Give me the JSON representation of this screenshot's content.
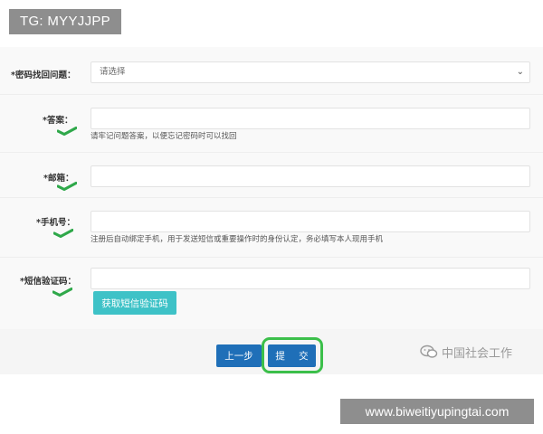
{
  "watermarks": {
    "top_left": "TG: MYYJJPP",
    "bottom_right": "www.biweitiyupingtai.com"
  },
  "form": {
    "security_question": {
      "label": "*密码找回问题：",
      "selected": "请选择"
    },
    "answer": {
      "label": "*答案：",
      "value": "",
      "hint": "请牢记问题答案，以便忘记密码时可以找回"
    },
    "email": {
      "label": "*邮箱：",
      "value": ""
    },
    "phone": {
      "label": "*手机号：",
      "value": "",
      "hint": "注册后自动绑定手机，用于发送短信或重要操作时的身份认定，务必填写本人现用手机"
    },
    "sms_code": {
      "label": "*短信验证码：",
      "value": "",
      "button": "获取短信验证码"
    }
  },
  "actions": {
    "prev": "上一步",
    "submit": "提 交"
  },
  "brand": {
    "name": "中国社会工作"
  },
  "colors": {
    "primary": "#1f6fb8",
    "sms_button": "#3ec2c7",
    "highlight": "#3bbf4a",
    "check": "#2fa84a"
  },
  "icons": {
    "select_arrow": "chevron-down-icon",
    "check": "checkmark-icon",
    "brand": "wechat-icon"
  }
}
